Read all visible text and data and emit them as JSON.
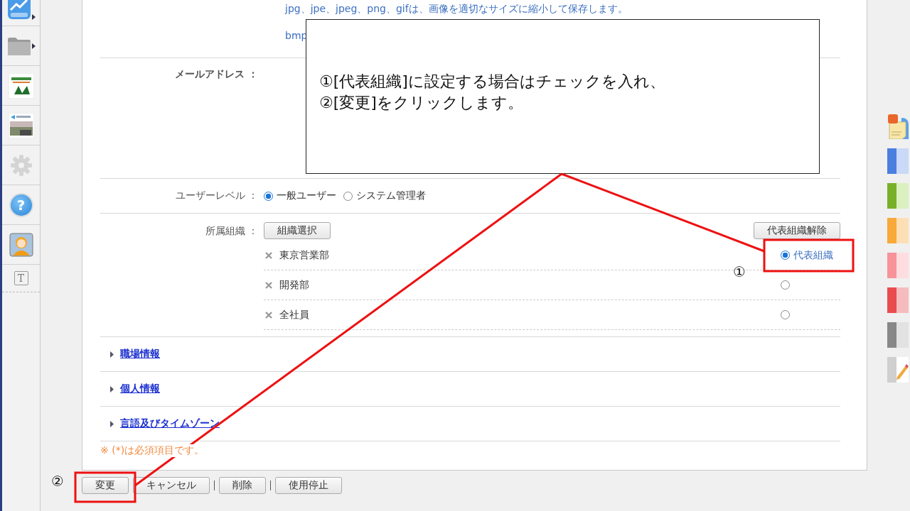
{
  "sidebar": {
    "help_glyph": "?",
    "text_tool_glyph": "T"
  },
  "image_notes": [
    "jpg、jpe、jpeg、png、gifは、画像を適切なサイズに縮小して保存します。",
    "bmp"
  ],
  "email": {
    "label": "メールアドレス ："
  },
  "user_level": {
    "label": "ユーザーレベル ：",
    "options": [
      {
        "label": "一般ユーザー",
        "selected": true
      },
      {
        "label": "システム管理者",
        "selected": false
      }
    ]
  },
  "organization": {
    "label": "所属組織 ：",
    "select_button": "組織選択",
    "clear_button": "代表組織解除",
    "items": [
      {
        "name": "東京営業部",
        "primary": true,
        "primary_label": "代表組織"
      },
      {
        "name": "開発部",
        "primary": false
      },
      {
        "name": "全社員",
        "primary": false
      }
    ]
  },
  "sections": [
    "職場情報",
    "個人情報",
    "言語及びタイムゾーン"
  ],
  "required_note": "※ (*)は必須項目です。",
  "buttons": [
    "変更",
    "キャンセル",
    "削除",
    "使用停止"
  ],
  "annotation": {
    "callout_lines": [
      "①[代表組織]に設定する場合はチェックを入れ、",
      "②[変更]をクリックします。"
    ],
    "markers": [
      "①",
      "②"
    ]
  }
}
